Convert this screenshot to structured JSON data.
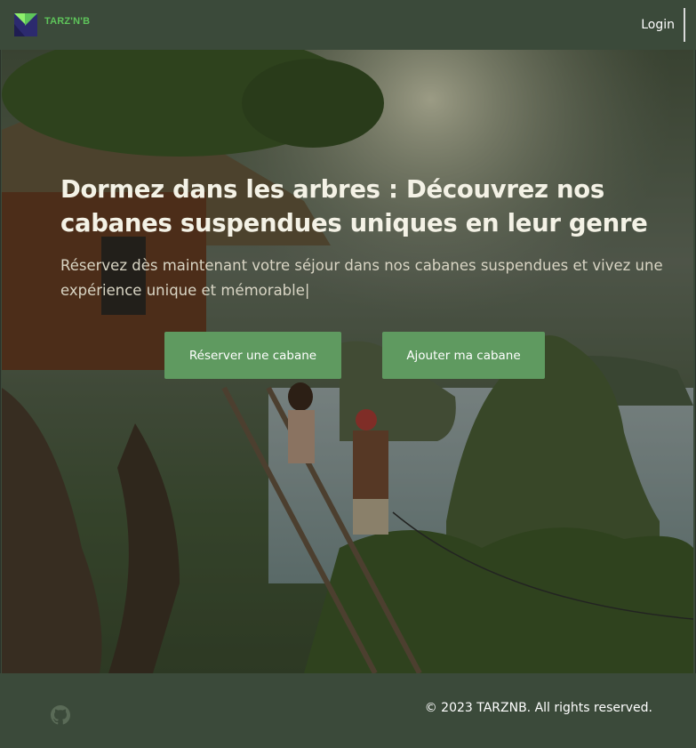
{
  "header": {
    "brand_name": "TARZ'N'B",
    "login_label": "Login",
    "colors": {
      "background": "#3b4a3a",
      "brand": "#5ec45a"
    }
  },
  "hero": {
    "title": "Dormez dans les arbres : Découvrez nos cabanes suspendues uniques en leur genre",
    "subtitle": "Réservez dès maintenant votre séjour dans nos cabanes suspendues et vivez une expérience unique et mémorable",
    "cursor": "|",
    "reserve_label": "Réserver une cabane",
    "add_label": "Ajouter ma cabane",
    "colors": {
      "button": "#5f9a60",
      "title": "#f4f2e6"
    }
  },
  "footer": {
    "github_icon": "github-icon",
    "copyright": "© 2023 TARZNB. All rights reserved."
  }
}
